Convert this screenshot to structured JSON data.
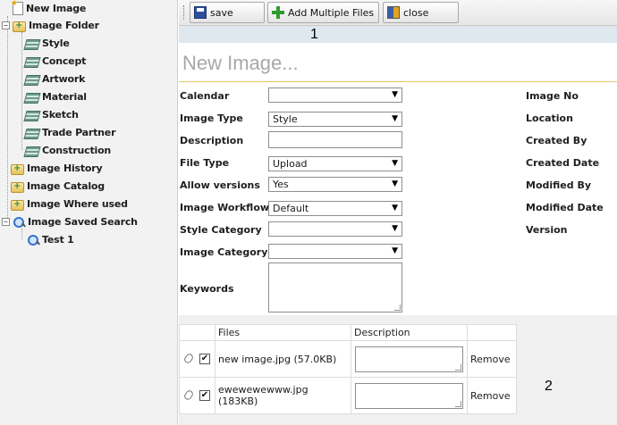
{
  "tree": {
    "new_image": "New Image",
    "image_folder": "Image Folder",
    "folder_children": [
      "Style",
      "Concept",
      "Artwork",
      "Material",
      "Sketch",
      "Trade Partner",
      "Construction"
    ],
    "image_history": "Image History",
    "image_catalog": "Image Catalog",
    "image_where_used": "Image Where used",
    "image_saved_search": "Image Saved Search",
    "saved_search_children": [
      "Test 1"
    ]
  },
  "toolbar": {
    "save": "save",
    "add_multiple": "Add Multiple Files",
    "close": "close"
  },
  "markers": {
    "one": "1",
    "two": "2"
  },
  "page": {
    "title": "New Image..."
  },
  "form": {
    "calendar_label": "Calendar",
    "calendar_value": "",
    "image_type_label": "Image Type",
    "image_type_value": "Style",
    "description_label": "Description",
    "file_type_label": "File Type",
    "file_type_value": "Upload",
    "allow_versions_label": "Allow versions",
    "allow_versions_value": "Yes",
    "image_workflow_label": "Image Workflow",
    "image_workflow_value": "Default",
    "style_category_label": "Style Category",
    "style_category_value": "",
    "image_category_label": "Image Category",
    "image_category_value": "",
    "keywords_label": "Keywords"
  },
  "meta_labels": [
    "Image No",
    "Location",
    "Created By",
    "Created Date",
    "Modified By",
    "Modified Date",
    "Version"
  ],
  "files": {
    "headers": {
      "files": "Files",
      "description": "Description"
    },
    "rows": [
      {
        "name": "new image.jpg (57.0KB)",
        "checked": true,
        "action": "Remove"
      },
      {
        "name": "ewewewewww.jpg (183KB)",
        "checked": true,
        "action": "Remove"
      }
    ]
  }
}
